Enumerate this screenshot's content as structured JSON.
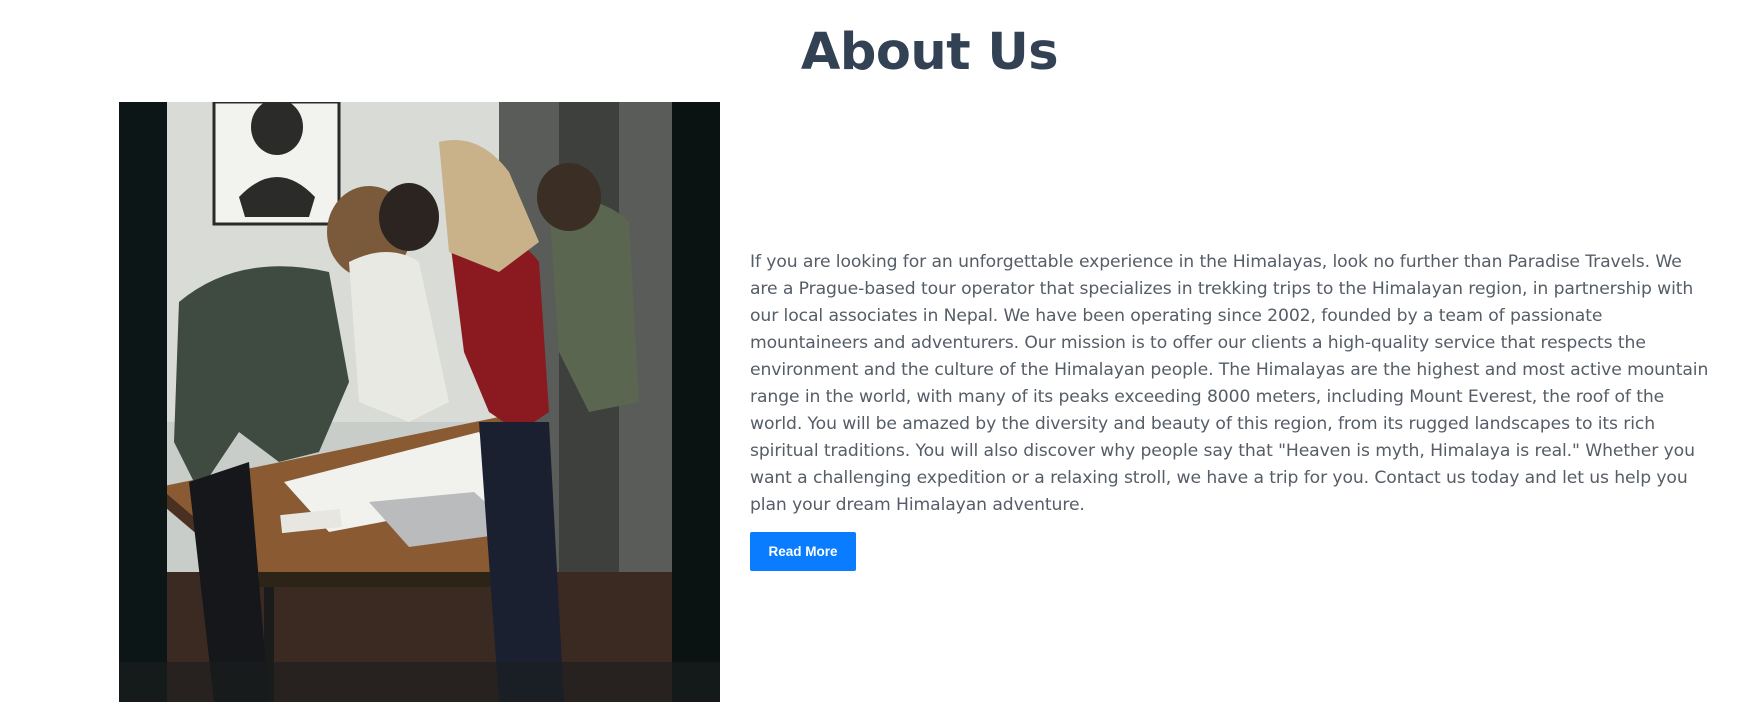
{
  "about": {
    "title": "About Us",
    "paragraph": "If you are looking for an unforgettable experience in the Himalayas, look no further than Paradise Travels. We are a Prague-based tour operator that specializes in trekking trips to the Himalayan region, in partnership with our local associates in Nepal. We have been operating since 2002, founded by a team of passionate mountaineers and adventurers. Our mission is to offer our clients a high-quality service that respects the environment and the culture of the Himalayan people. The Himalayas are the highest and most active mountain range in the world, with many of its peaks exceeding 8000 meters, including Mount Everest, the roof of the world. You will be amazed by the diversity and beauty of this region, from its rugged landscapes to its rich spiritual traditions. You will also discover why people say that \"Heaven is myth, Himalaya is real.\" Whether you want a challenging expedition or a relaxing stroll, we have a trip for you. Contact us today and let us help you plan your dream Himalayan adventure.",
    "button_label": "Read More"
  },
  "colors": {
    "heading": "#334155",
    "body_text": "#555d66",
    "button_bg": "#0a7cff",
    "button_text": "#ffffff"
  }
}
